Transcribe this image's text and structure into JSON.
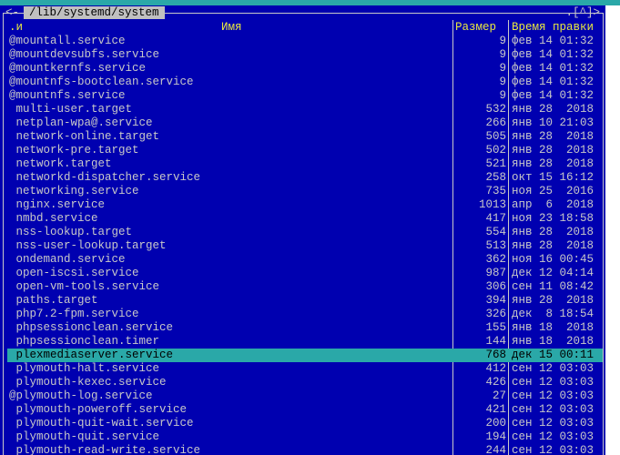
{
  "panel": {
    "path": "/lib/systemd/system",
    "left_corner": "<-",
    "right_corner": ".[^]>"
  },
  "columns": {
    "sort": ".и",
    "name": "Имя",
    "size": "Размер",
    "mtime": "Время правки"
  },
  "files": [
    {
      "name": "@mountall.service",
      "size": "9",
      "mtime": "фев 14 01:32"
    },
    {
      "name": "@mountdevsubfs.service",
      "size": "9",
      "mtime": "фев 14 01:32"
    },
    {
      "name": "@mountkernfs.service",
      "size": "9",
      "mtime": "фев 14 01:32"
    },
    {
      "name": "@mountnfs-bootclean.service",
      "size": "9",
      "mtime": "фев 14 01:32"
    },
    {
      "name": "@mountnfs.service",
      "size": "9",
      "mtime": "фев 14 01:32"
    },
    {
      "name": " multi-user.target",
      "size": "532",
      "mtime": "янв 28  2018"
    },
    {
      "name": " netplan-wpa@.service",
      "size": "266",
      "mtime": "янв 10 21:03"
    },
    {
      "name": " network-online.target",
      "size": "505",
      "mtime": "янв 28  2018"
    },
    {
      "name": " network-pre.target",
      "size": "502",
      "mtime": "янв 28  2018"
    },
    {
      "name": " network.target",
      "size": "521",
      "mtime": "янв 28  2018"
    },
    {
      "name": " networkd-dispatcher.service",
      "size": "258",
      "mtime": "окт 15 16:12"
    },
    {
      "name": " networking.service",
      "size": "735",
      "mtime": "ноя 25  2016"
    },
    {
      "name": " nginx.service",
      "size": "1013",
      "mtime": "апр  6  2018"
    },
    {
      "name": " nmbd.service",
      "size": "417",
      "mtime": "ноя 23 18:58"
    },
    {
      "name": " nss-lookup.target",
      "size": "554",
      "mtime": "янв 28  2018"
    },
    {
      "name": " nss-user-lookup.target",
      "size": "513",
      "mtime": "янв 28  2018"
    },
    {
      "name": " ondemand.service",
      "size": "362",
      "mtime": "ноя 16 00:45"
    },
    {
      "name": " open-iscsi.service",
      "size": "987",
      "mtime": "дек 12 04:14"
    },
    {
      "name": " open-vm-tools.service",
      "size": "306",
      "mtime": "сен 11 08:42"
    },
    {
      "name": " paths.target",
      "size": "394",
      "mtime": "янв 28  2018"
    },
    {
      "name": " php7.2-fpm.service",
      "size": "326",
      "mtime": "дек  8 18:54"
    },
    {
      "name": " phpsessionclean.service",
      "size": "155",
      "mtime": "янв 18  2018"
    },
    {
      "name": " phpsessionclean.timer",
      "size": "144",
      "mtime": "янв 18  2018"
    },
    {
      "name": " plexmediaserver.service",
      "size": "768",
      "mtime": "дек 15 00:11",
      "selected": true
    },
    {
      "name": " plymouth-halt.service",
      "size": "412",
      "mtime": "сен 12 03:03"
    },
    {
      "name": " plymouth-kexec.service",
      "size": "426",
      "mtime": "сен 12 03:03"
    },
    {
      "name": "@plymouth-log.service",
      "size": "27",
      "mtime": "сен 12 03:03"
    },
    {
      "name": " plymouth-poweroff.service",
      "size": "421",
      "mtime": "сен 12 03:03"
    },
    {
      "name": " plymouth-quit-wait.service",
      "size": "200",
      "mtime": "сен 12 03:03"
    },
    {
      "name": " plymouth-quit.service",
      "size": "194",
      "mtime": "сен 12 03:03"
    },
    {
      "name": " plymouth-read-write.service",
      "size": "244",
      "mtime": "сен 12 03:03"
    }
  ]
}
